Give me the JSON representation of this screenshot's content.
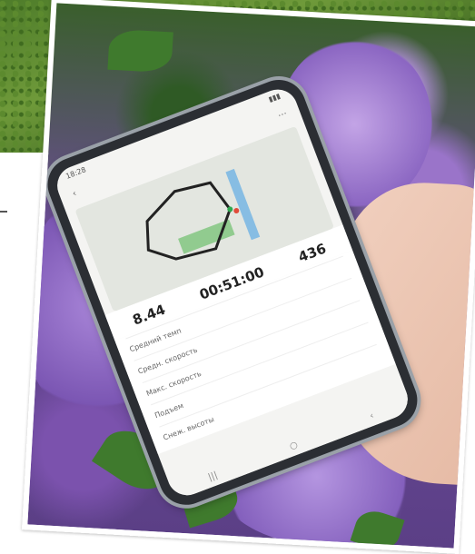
{
  "phone": {
    "status": {
      "time": "18:28",
      "right": ""
    },
    "stats": [
      {
        "value": "8.44",
        "unit": ""
      },
      {
        "value": "00:51:00",
        "unit": ""
      },
      {
        "value": "436",
        "unit": ""
      }
    ],
    "rows": [
      {
        "label": "Средний темп",
        "value": ""
      },
      {
        "label": "Средн. скорость",
        "value": ""
      },
      {
        "label": "Макс. скорость",
        "value": ""
      },
      {
        "label": "Подъем",
        "value": ""
      },
      {
        "label": "Снеж. высоты",
        "value": ""
      }
    ]
  },
  "colors": {
    "lilac": "#9a74c9",
    "leaf": "#3f7a2d",
    "route": "#222222",
    "map_water": "#6fb3e4",
    "map_park": "#7cc47a"
  }
}
